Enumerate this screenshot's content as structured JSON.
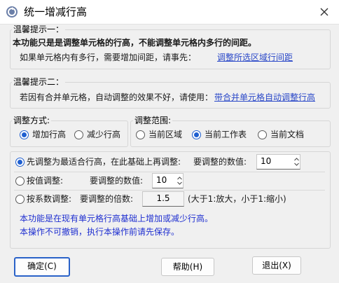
{
  "window": {
    "title": "统一增减行高",
    "app_icon": "refresh-circle-icon",
    "close_icon": "close-icon"
  },
  "tip1": {
    "legend": "温馨提示一：",
    "bold_text": "本功能只是是调整单元格的行高，不能调整单元格内多行的间距。",
    "text": "如果单元格内有多行，需要增加间距，请事先：",
    "link": "调整所选区域行间距"
  },
  "tip2": {
    "legend": "温馨提示二：",
    "text": "若因有合并单元格，自动调整的效果不好，请使用：",
    "link": "带合并单元格自动调整行高"
  },
  "mode": {
    "legend": "调整方式:",
    "options": [
      {
        "label": "增加行高",
        "selected": true
      },
      {
        "label": "减少行高",
        "selected": false
      }
    ]
  },
  "range": {
    "legend": "调整范围:",
    "options": [
      {
        "label": "当前区域",
        "selected": false
      },
      {
        "label": "当前工作表",
        "selected": true
      },
      {
        "label": "当前文档",
        "selected": false
      }
    ]
  },
  "methods": {
    "fit_first": {
      "label": "先调整为最适合行高，在此基础上再调整:",
      "value_label": "要调整的数值:",
      "value": "10",
      "selected": true
    },
    "by_value": {
      "label": "按值调整:",
      "value_label": "要调整的数值:",
      "value": "10",
      "selected": false
    },
    "by_factor": {
      "label": "按系数调整:",
      "value_label": "要调整的倍数:",
      "value": "1.5",
      "hint": "(大于1:放大，小于1:缩小)",
      "selected": false
    },
    "note1": "本功能是在现有单元格行高基础上增加或减少行高。",
    "note2": "本操作不可撤销，执行本操作前请先保存。"
  },
  "buttons": {
    "ok": "确定(C)",
    "help": "帮助(H)",
    "exit": "退出(X)"
  },
  "colors": {
    "accent": "#1f5fd0",
    "link": "#2a48c8",
    "note": "#1f2fd0"
  }
}
